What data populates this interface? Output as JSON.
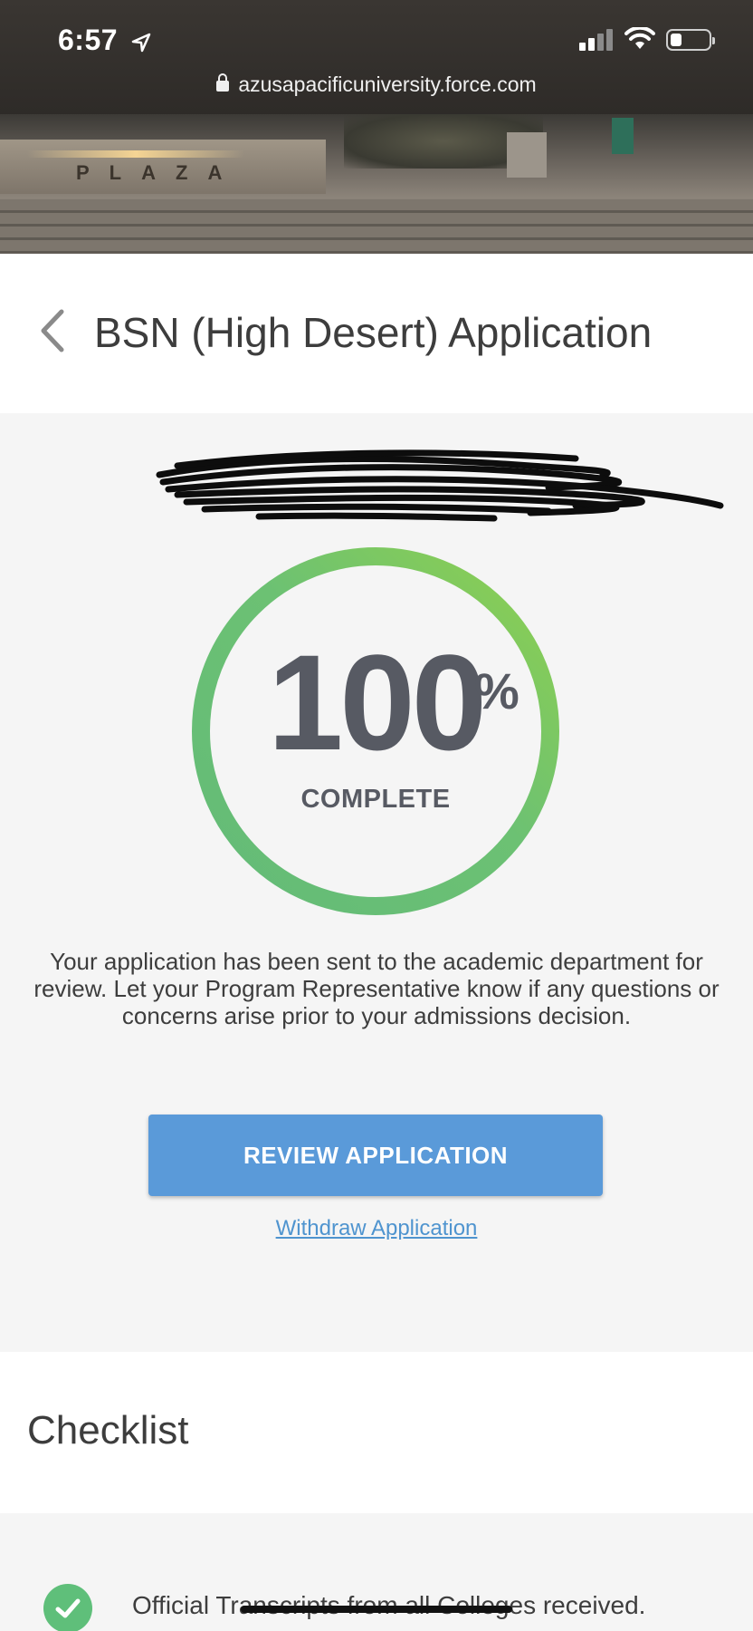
{
  "status_bar": {
    "time": "6:57",
    "url": "azusapacificuniversity.force.com",
    "battery_level": 0.2,
    "signal_bars": 2,
    "signal_bars_total": 4
  },
  "hero": {
    "sign_text": "PLAZA"
  },
  "header": {
    "title": "BSN (High Desert) Application",
    "back_icon": "chevron-left-icon"
  },
  "progress": {
    "value": 100,
    "number": "100",
    "percent_sign": "%",
    "label": "COMPLETE",
    "ring_color_start": "#63bb78",
    "ring_color_end": "#8fd04f"
  },
  "message": "Your application has been sent to the academic department for review. Let your Program Representative know if any questions or concerns arise prior to your admissions decision.",
  "actions": {
    "review_label": "REVIEW APPLICATION",
    "withdraw_label": "Withdraw Application"
  },
  "checklist": {
    "title": "Checklist",
    "items": [
      {
        "text": "Official Transcripts from all Colleges received.",
        "status": "complete",
        "icon": "check-circle-icon"
      }
    ]
  },
  "colors": {
    "accent": "#5a9ad9",
    "link": "#4f94cf",
    "success": "#5fbf7a",
    "text": "#3d3d3d"
  }
}
